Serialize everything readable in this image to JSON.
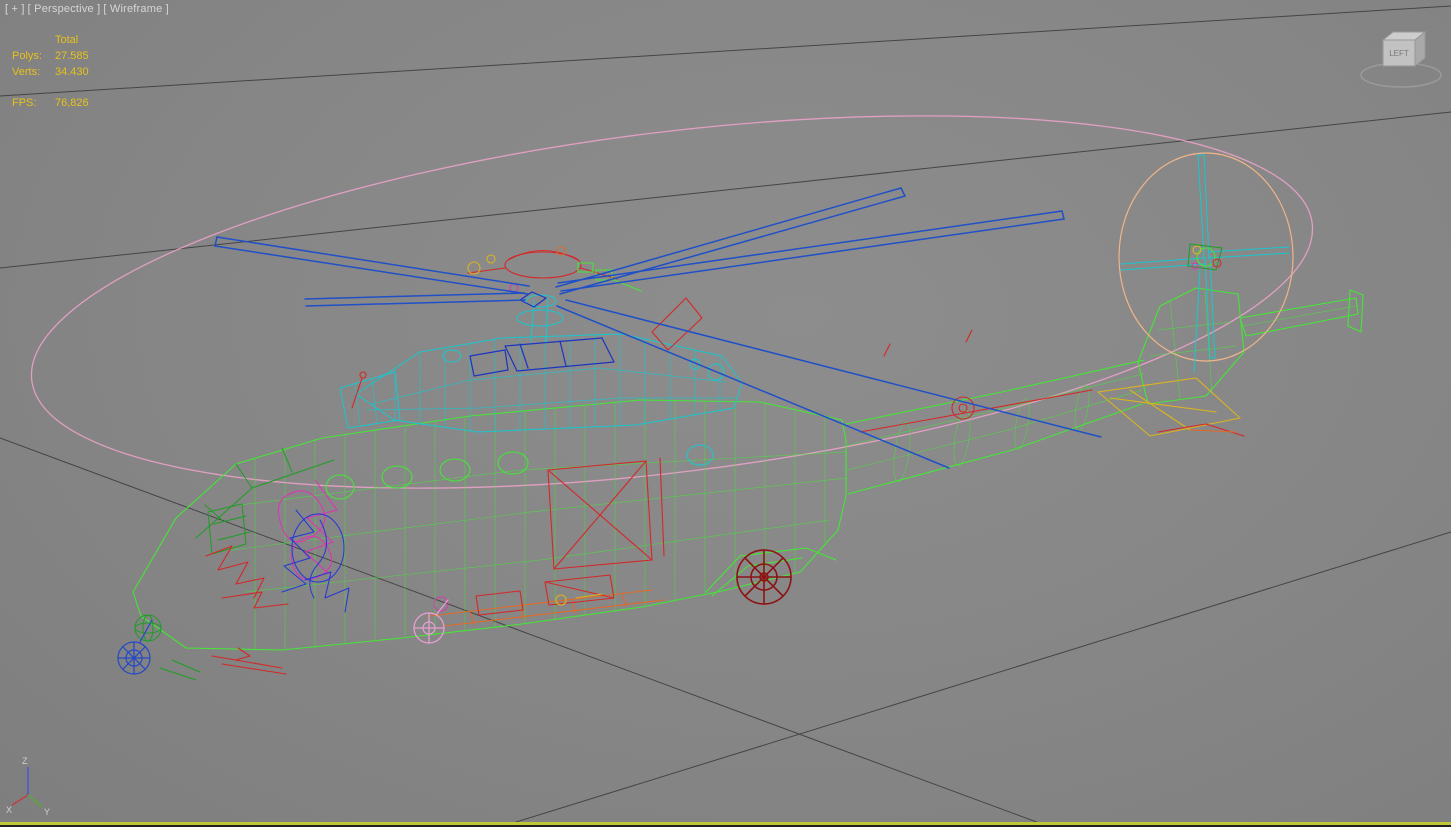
{
  "viewport": {
    "label": {
      "plus": "[ + ]",
      "view": "[ Perspective ]",
      "shading": "[ Wireframe ]"
    }
  },
  "stats": {
    "total_label": "Total",
    "polys_label": "Polys:",
    "polys_value": "27.585",
    "verts_label": "Verts:",
    "verts_value": "34.430",
    "fps_label": "FPS:",
    "fps_value": "76,826"
  },
  "viewcube": {
    "face_label": "LEFT"
  },
  "axis_gizmo": {
    "x": "X",
    "y": "Y",
    "z": "Z"
  },
  "colors": {
    "grid": "#454545",
    "label_gray": "#d6d6d6",
    "stats_yellow": "#e6c11c",
    "border_yellow": "#bfc739",
    "disc_pink": "#f0a3cd",
    "blade_blue": "#2050c8",
    "fuselage_green": "#45e637",
    "dark_green": "#1e9e22",
    "engine_cyan": "#17c8cf",
    "deep_blue": "#1a35c0",
    "detail_red": "#d42828",
    "detail_orange": "#e06a28",
    "detail_yellow": "#dcb41e",
    "cockpit_magenta": "#e032b4",
    "cockpit_blue": "#2438d8",
    "tail_disc_peach": "#efb488",
    "wheel_darkred": "#8c1414",
    "wheel_pink": "#eaa0d4",
    "wheel_blue": "#2448c8"
  }
}
